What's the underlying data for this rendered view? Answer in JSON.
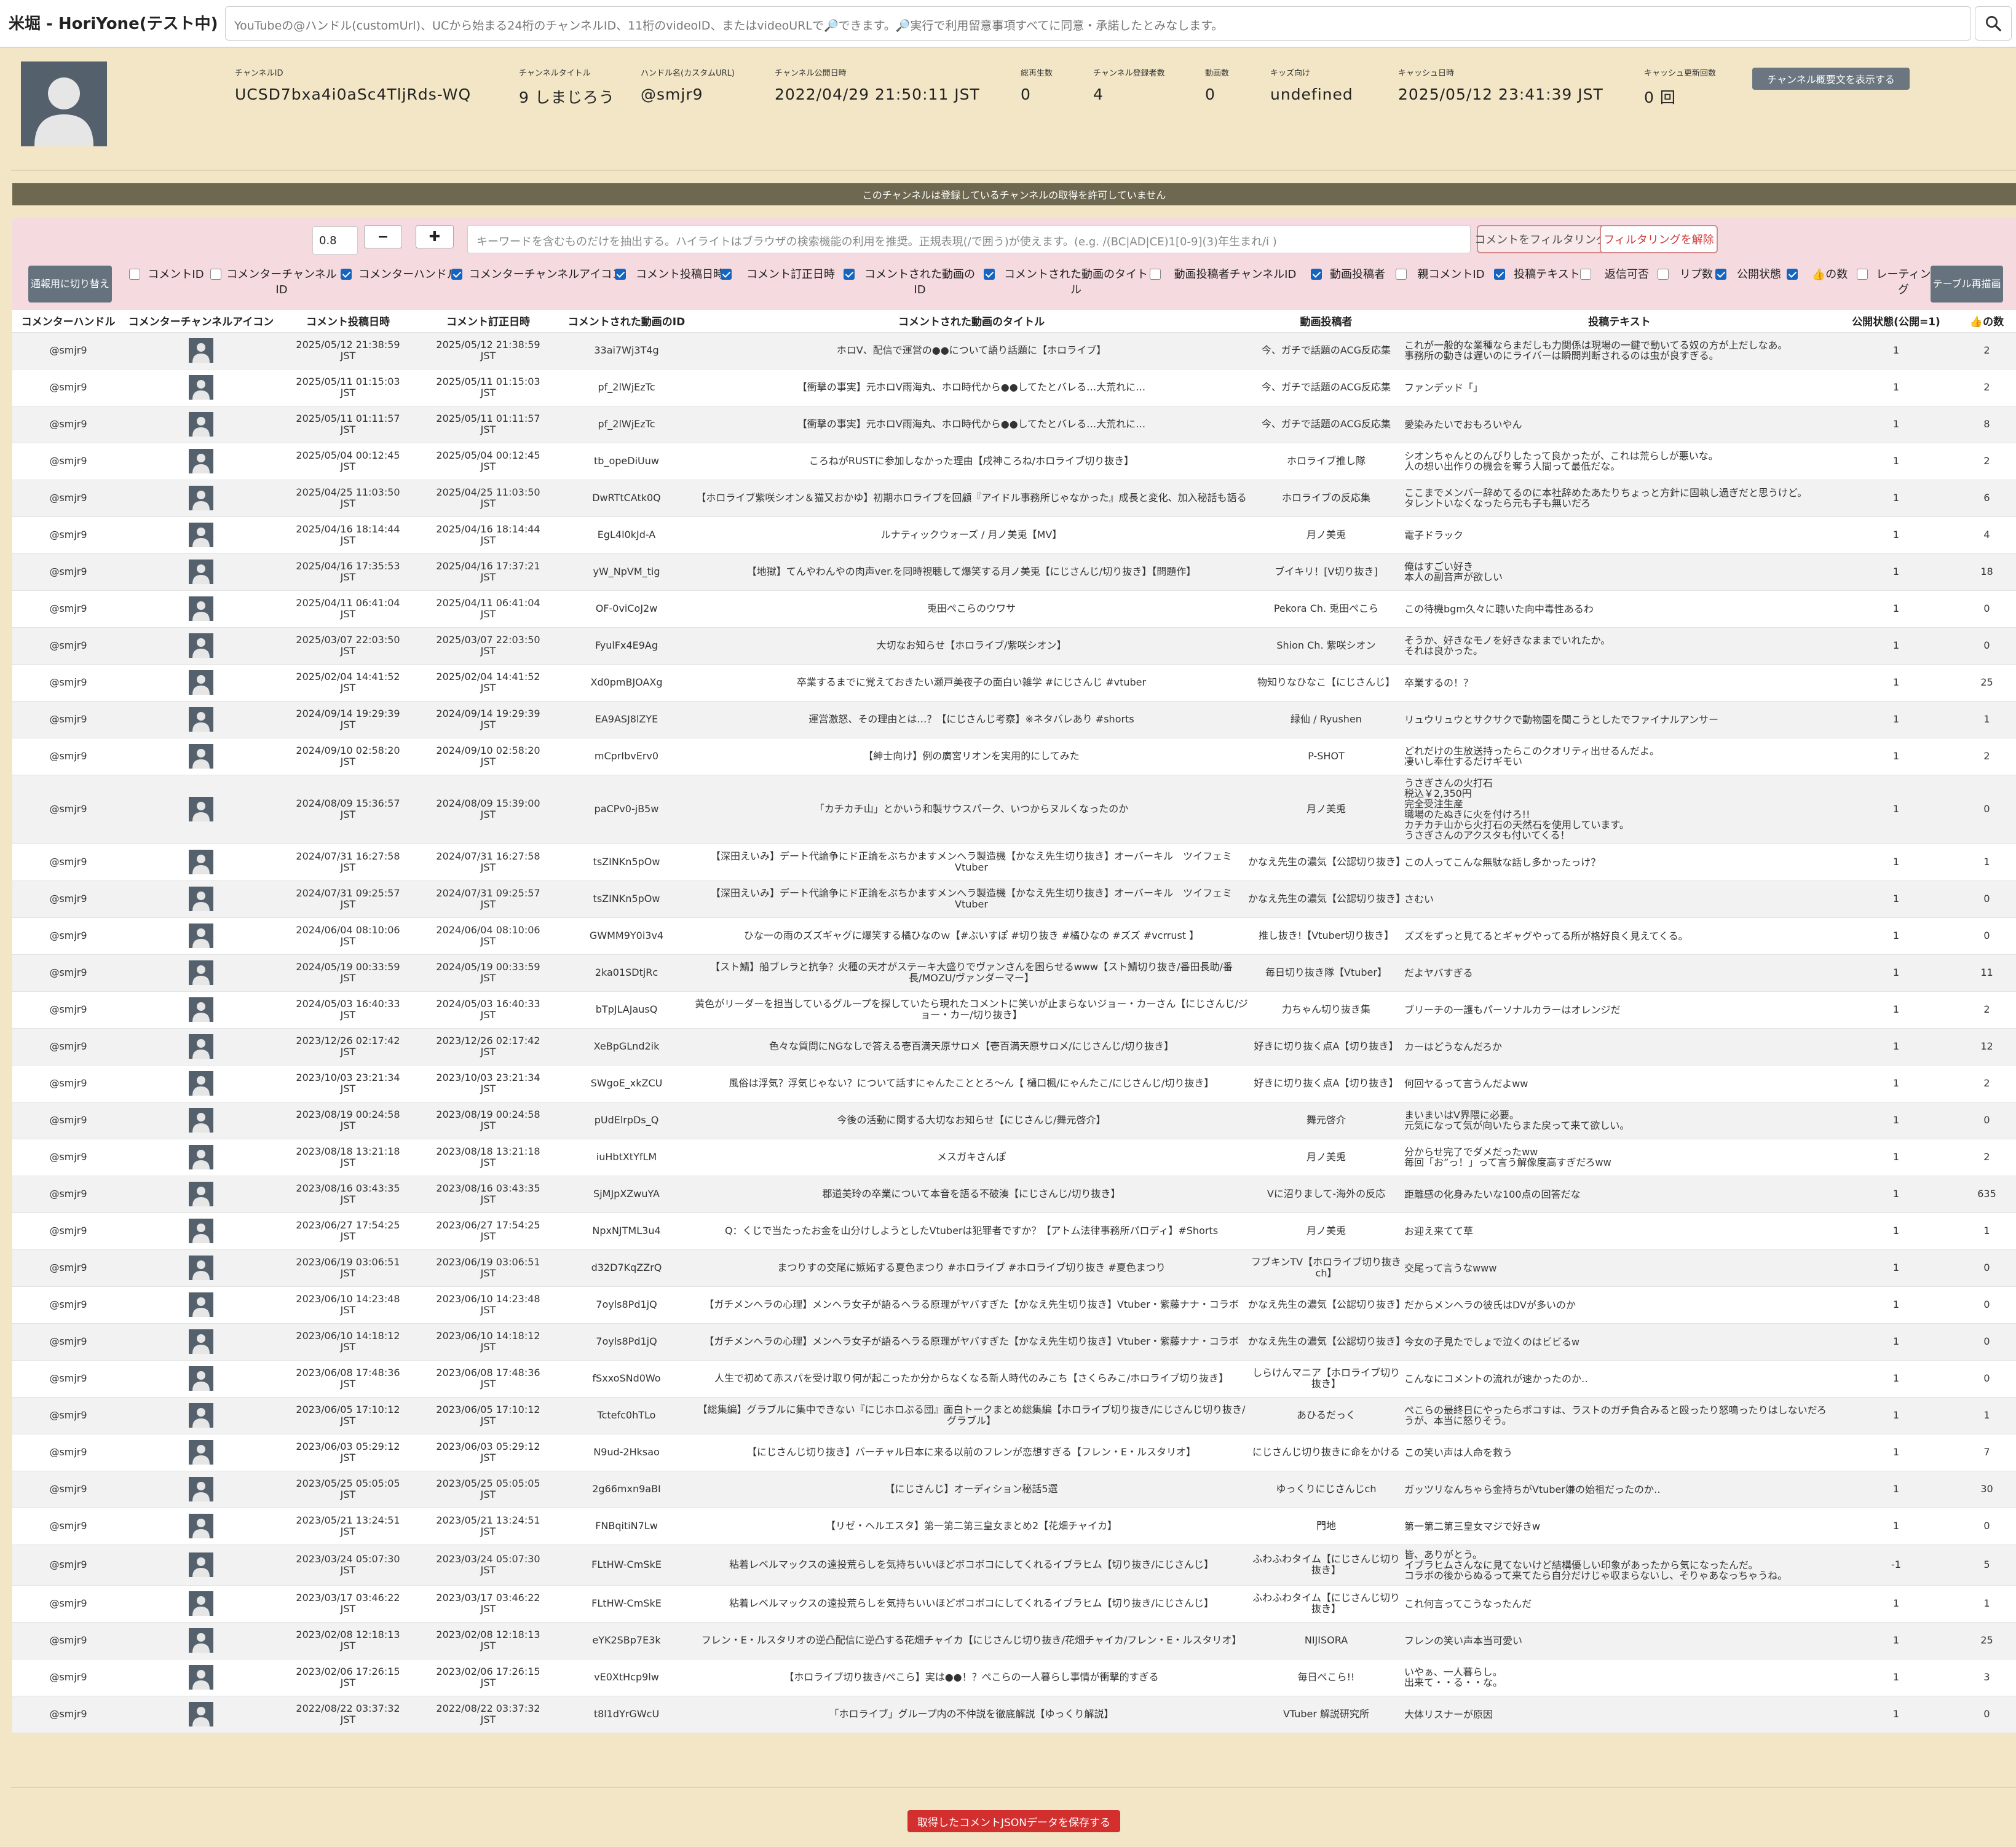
{
  "app": {
    "title": "米堀 - HoriYone(テスト中)"
  },
  "search": {
    "placeholder": "YouTubeの@ハンドル(customUrl)、UCから始まる24桁のチャンネルID、11桁のvideoID、またはvideoURLで🔎できます。🔎実行で利用留意事項すべてに同意・承諾したとみなします。"
  },
  "channel": {
    "id_label": "チャンネルID",
    "id": "UCSD7bxa4i0aSc4TljRds-WQ",
    "title_label": "チャンネルタイトル",
    "title": "9 しまじろう",
    "handle_label": "ハンドル名(カスタムURL)",
    "handle": "@smjr9",
    "published_label": "チャンネル公開日時",
    "published": "2022/04/29 21:50:11 JST",
    "views_label": "総再生数",
    "views": "0",
    "subs_label": "チャンネル登録者数",
    "subs": "4",
    "videos_label": "動画数",
    "videos": "0",
    "kids_label": "キッズ向け",
    "kids": "undefined",
    "cache_label": "キャッシュ日時",
    "cache": "2025/05/12 23:41:39 JST",
    "cache_count_label": "キャッシュ更新回数",
    "cache_count": "0 回",
    "desc_button": "チャンネル概要文を表示する"
  },
  "notice": "このチャンネルは登録しているチャンネルの取得を許可していません",
  "filter": {
    "threshold": "0.8",
    "minus": "−",
    "plus": "✚",
    "keyword_placeholder": "キーワードを含むものだけを抽出する。ハイライトはブラウザの検索機能の利用を推奨。正規表現(/で囲う)が使えます。(e.g. /(BC|AD|CE)1[0-9](3)年生まれ/i )",
    "apply_button": "コメントをフィルタリング",
    "clear_button": "フィルタリングを解除",
    "toggle_button": "通報用に切り替え",
    "rerender_button": "テーブル再描画",
    "columns": [
      {
        "label": "コメントID",
        "checked": false
      },
      {
        "label": "コメンターチャンネルID",
        "checked": false
      },
      {
        "label": "コメンターハンドル",
        "checked": true
      },
      {
        "label": "コメンターチャンネルアイコン",
        "checked": true
      },
      {
        "label": "コメント投稿日時",
        "checked": true
      },
      {
        "label": "コメント訂正日時",
        "checked": true
      },
      {
        "label": "コメントされた動画のID",
        "checked": true
      },
      {
        "label": "コメントされた動画のタイトル",
        "checked": true
      },
      {
        "label": "動画投稿者チャンネルID",
        "checked": false
      },
      {
        "label": "動画投稿者",
        "checked": true
      },
      {
        "label": "親コメントID",
        "checked": false
      },
      {
        "label": "投稿テキスト",
        "checked": true
      },
      {
        "label": "返信可否",
        "checked": false
      },
      {
        "label": "リプ数",
        "checked": false
      },
      {
        "label": "公開状態",
        "checked": true
      },
      {
        "label": "👍の数",
        "checked": true
      },
      {
        "label": "レーティング",
        "checked": false
      }
    ]
  },
  "table": {
    "headers": [
      "コメンターハンドル",
      "コメンターチャンネルアイコン",
      "コメント投稿日時",
      "コメント訂正日時",
      "コメントされた動画のID",
      "コメントされた動画のタイトル",
      "動画投稿者",
      "投稿テキスト",
      "公開状態(公開=1)",
      "👍の数"
    ],
    "rows": [
      {
        "handle": "@smjr9",
        "posted": "2025/05/12 21:38:59",
        "edited": "2025/05/12 21:38:59",
        "edited_red": false,
        "vid": "33ai7Wj3T4g",
        "title": "ホロV、配信で運営の●●について語り話題に【ホロライブ】",
        "uploader": "今、ガチで話題のACG反応集",
        "text": "これが一般的な業種ならまだしも力関係は現場の一鍵で動いてる奴の方が上だしなあ。\n事務所の動きは遅いのにライバーは瞬間判断されるのは虫が良すぎる。",
        "status": "1",
        "likes": "2"
      },
      {
        "handle": "@smjr9",
        "posted": "2025/05/11 01:15:03",
        "edited": "2025/05/11 01:15:03",
        "edited_red": false,
        "vid": "pf_2lWjEzTc",
        "title": "【衝撃の事実】元ホロV雨海丸、ホロ時代から●●してたとバレる…大荒れに…",
        "uploader": "今、ガチで話題のACG反応集",
        "text": "ファンデッド「」",
        "status": "1",
        "likes": "2"
      },
      {
        "handle": "@smjr9",
        "posted": "2025/05/11 01:11:57",
        "edited": "2025/05/11 01:11:57",
        "edited_red": false,
        "vid": "pf_2lWjEzTc",
        "title": "【衝撃の事実】元ホロV雨海丸、ホロ時代から●●してたとバレる…大荒れに…",
        "uploader": "今、ガチで話題のACG反応集",
        "text": "愛染みたいでおもろいやん",
        "status": "1",
        "likes": "8"
      },
      {
        "handle": "@smjr9",
        "posted": "2025/05/04 00:12:45",
        "edited": "2025/05/04 00:12:45",
        "edited_red": false,
        "vid": "tb_opeDiUuw",
        "title": "ころねがRUSTに参加しなかった理由【戌神ころね/ホロライブ切り抜き】",
        "uploader": "ホロライブ推し隊",
        "text": "シオンちゃんとのんびりしたって良かったが、これは荒らしが悪いな。\n人の想い出作りの機会を奪う人間って最低だな。",
        "status": "1",
        "likes": "2"
      },
      {
        "handle": "@smjr9",
        "posted": "2025/04/25 11:03:50",
        "edited": "2025/04/25 11:03:50",
        "edited_red": false,
        "vid": "DwRTtCAtk0Q",
        "title": "【ホロライブ紫咲シオン＆猫又おかゆ】初期ホロライブを回顧『アイドル事務所じゃなかった』成長と変化、加入秘話も語る",
        "uploader": "ホロライブの反応集",
        "text": "ここまでメンバー辞めてるのに本社辞めたあたりちょっと方針に固執し過ぎだと思うけど。\nタレントいなくなったら元も子も無いだろ",
        "status": "1",
        "likes": "6"
      },
      {
        "handle": "@smjr9",
        "posted": "2025/04/16 18:14:44",
        "edited": "2025/04/16 18:14:44",
        "edited_red": false,
        "vid": "EgL4l0kJd-A",
        "title": "ルナティックウォーズ / 月ノ美兎【MV】",
        "uploader": "月ノ美兎",
        "text": "電子ドラック",
        "status": "1",
        "likes": "4"
      },
      {
        "handle": "@smjr9",
        "posted": "2025/04/16 17:35:53",
        "edited": "2025/04/16 17:37:21",
        "edited_red": true,
        "vid": "yW_NpVM_tig",
        "title": "【地獄】てんやわんやの肉声ver.を同時視聴して爆笑する月ノ美兎【にじさんじ/切り抜き】【問題作】",
        "uploader": "ブイキリ！[V切り抜き]",
        "text": "俺はすごい好き\n本人の副音声が欲しい",
        "status": "1",
        "likes": "18"
      },
      {
        "handle": "@smjr9",
        "posted": "2025/04/11 06:41:04",
        "edited": "2025/04/11 06:41:04",
        "edited_red": false,
        "vid": "OF-0viCoJ2w",
        "title": "兎田ぺこらのウワサ",
        "uploader": "Pekora Ch. 兎田ぺこら",
        "text": "この待機bgm久々に聴いた向中毒性あるわ",
        "status": "1",
        "likes": "0"
      },
      {
        "handle": "@smjr9",
        "posted": "2025/03/07 22:03:50",
        "edited": "2025/03/07 22:03:50",
        "edited_red": false,
        "vid": "FyulFx4E9Ag",
        "title": "大切なお知らせ【ホロライブ/紫咲シオン】",
        "uploader": "Shion Ch. 紫咲シオン",
        "text": "そうか、好きなモノを好きなままでいれたか。\nそれは良かった。",
        "status": "1",
        "likes": "0"
      },
      {
        "handle": "@smjr9",
        "posted": "2025/02/04 14:41:52",
        "edited": "2025/02/04 14:41:52",
        "edited_red": false,
        "vid": "Xd0pmBJOAXg",
        "title": "卒業するまでに覚えておきたい瀬戸美夜子の面白い雑学 #にじさんじ #vtuber",
        "uploader": "物知りなひなこ【にじさんじ】",
        "text": "卒業するの！？",
        "status": "1",
        "likes": "25"
      },
      {
        "handle": "@smjr9",
        "posted": "2024/09/14 19:29:39",
        "edited": "2024/09/14 19:29:39",
        "edited_red": false,
        "vid": "EA9ASJ8lZYE",
        "title": "運営激怒、その理由とは…？【にじさんじ考察】※ネタバレあり #shorts",
        "uploader": "緑仙 / Ryushen",
        "text": "リュウリュウとサクサクで動物園を聞こうとしたでファイナルアンサー",
        "status": "1",
        "likes": "1"
      },
      {
        "handle": "@smjr9",
        "posted": "2024/09/10 02:58:20",
        "edited": "2024/09/10 02:58:20",
        "edited_red": false,
        "vid": "mCprIbvErv0",
        "title": "【紳士向け】例の廣宮リオンを実用的にしてみた",
        "uploader": "P-SHOT",
        "text": "どれだけの生放送持ったらこのクオリティ出せるんだよ。\n凄いし奉仕するだけギモい",
        "status": "1",
        "likes": "2"
      },
      {
        "handle": "@smjr9",
        "posted": "2024/08/09 15:36:57",
        "edited": "2024/08/09 15:39:00",
        "edited_red": true,
        "vid": "paCPv0-jB5w",
        "title": "「カチカチ山」とかいう和製サウスパーク、いつからヌルくなったのか",
        "uploader": "月ノ美兎",
        "text": "うさぎさんの火打石\n税込￥2,350円\n完全受注生産\n職場のたぬきに火を付けろ!!\nカチカチ山から火打石の天然石を使用しています。\nうさぎさんのアクスタも付いてくる！",
        "status": "1",
        "likes": "0"
      },
      {
        "handle": "@smjr9",
        "posted": "2024/07/31 16:27:58",
        "edited": "2024/07/31 16:27:58",
        "edited_red": false,
        "vid": "tsZINKn5pOw",
        "title": "【深田えいみ】デート代論争にド正論をぶちかますメンヘラ製造機【かなえ先生切り抜き】オーバーキル　ツイフェミ　Vtuber",
        "uploader": "かなえ先生の濃気【公認切り抜き】",
        "text": "この人ってこんな無駄な話し多かったっけ？",
        "status": "1",
        "likes": "1"
      },
      {
        "handle": "@smjr9",
        "posted": "2024/07/31 09:25:57",
        "edited": "2024/07/31 09:25:57",
        "edited_red": false,
        "vid": "tsZINKn5pOw",
        "title": "【深田えいみ】デート代論争にド正論をぶちかますメンヘラ製造機【かなえ先生切り抜き】オーバーキル　ツイフェミ　Vtuber",
        "uploader": "かなえ先生の濃気【公認切り抜き】",
        "text": "さむい",
        "status": "1",
        "likes": "0"
      },
      {
        "handle": "@smjr9",
        "posted": "2024/06/04 08:10:06",
        "edited": "2024/06/04 08:10:06",
        "edited_red": false,
        "vid": "GWMM9Y0i3v4",
        "title": "ひな一の雨のズズギャグに爆笑する橘ひなのｗ【#ぶいすぽ #切り抜き #橘ひなの #ズズ #vcrrust 】",
        "uploader": "推し抜き!【Vtuber切り抜き】",
        "text": "ズズをずっと見てるとギャグやってる所が格好良く見えてくる。",
        "status": "1",
        "likes": "0"
      },
      {
        "handle": "@smjr9",
        "posted": "2024/05/19 00:33:59",
        "edited": "2024/05/19 00:33:59",
        "edited_red": false,
        "vid": "2ka01SDtjRc",
        "title": "【スト鯖】船ブレラと抗争？火種の天才がステーキ大盛りでヴァンさんを困らせるwww【スト鯖切り抜き/番田長助/番長/MOZU/ヴァンダーマー】",
        "uploader": "毎日切り抜き隊【Vtuber】",
        "text": "だよヤバすぎる",
        "status": "1",
        "likes": "11"
      },
      {
        "handle": "@smjr9",
        "posted": "2024/05/03 16:40:33",
        "edited": "2024/05/03 16:40:33",
        "edited_red": false,
        "vid": "bTpJLAJausQ",
        "title": "黄色がリーダーを担当しているグループを探していたら現れたコメントに笑いが止まらないジョー・カーさん【にじさんじ/ジョー・カー/切り抜き】",
        "uploader": "力ちゃん切り抜き集",
        "text": "ブリーチの一護もパーソナルカラーはオレンジだ",
        "status": "1",
        "likes": "2"
      },
      {
        "handle": "@smjr9",
        "posted": "2023/12/26 02:17:42",
        "edited": "2023/12/26 02:17:42",
        "edited_red": false,
        "vid": "XeBpGLnd2ik",
        "title": "色々な質問にNGなしで答える壱百満天原サロメ【壱百満天原サロメ/にじさんじ/切り抜き】",
        "uploader": "好きに切り抜く点A【切り抜き】",
        "text": "カーはどうなんだろか",
        "status": "1",
        "likes": "12"
      },
      {
        "handle": "@smjr9",
        "posted": "2023/10/03 23:21:34",
        "edited": "2023/10/03 23:21:34",
        "edited_red": false,
        "vid": "SWgoE_xkZCU",
        "title": "風俗は浮気？浮気じゃない？について話すにゃんたこととろ～ん【 樋口楓/にゃんたこ/にじさんじ/切り抜き】",
        "uploader": "好きに切り抜く点A【切り抜き】",
        "text": "何回ヤるって言うんだよww",
        "status": "1",
        "likes": "2"
      },
      {
        "handle": "@smjr9",
        "posted": "2023/08/19 00:24:58",
        "edited": "2023/08/19 00:24:58",
        "edited_red": false,
        "vid": "pUdElrpDs_Q",
        "title": "今後の活動に関する大切なお知らせ【にじさんじ/舞元啓介】",
        "uploader": "舞元啓介",
        "text": "まいまいはV界隈に必要。\n元気になって気が向いたらまた戻って来て欲しい。",
        "status": "1",
        "likes": "0"
      },
      {
        "handle": "@smjr9",
        "posted": "2023/08/18 13:21:18",
        "edited": "2023/08/18 13:21:18",
        "edited_red": false,
        "vid": "iuHbtXtYfLM",
        "title": "メスガキさんぽ",
        "uploader": "月ノ美兎",
        "text": "分からせ完了でダメだったww\n毎回「お”っ！」って言う解像度高すぎだろww",
        "status": "1",
        "likes": "2"
      },
      {
        "handle": "@smjr9",
        "posted": "2023/08/16 03:43:35",
        "edited": "2023/08/16 03:43:35",
        "edited_red": false,
        "vid": "SjMJpXZwuYA",
        "title": "郡道美玲の卒業について本音を語る不破湊【にじさんじ/切り抜き】",
        "uploader": "Vに沼りまして-海外の反応",
        "text": "距離感の化身みたいな100点の回答だな",
        "status": "1",
        "likes": "635"
      },
      {
        "handle": "@smjr9",
        "posted": "2023/06/27 17:54:25",
        "edited": "2023/06/27 17:54:25",
        "edited_red": false,
        "vid": "NpxNJTML3u4",
        "title": "Q：くじで当たったお金を山分けしようとしたVtuberは犯罪者ですか？【アトム法律事務所パロディ】#Shorts",
        "uploader": "月ノ美兎",
        "text": "お迎え来てて草",
        "status": "1",
        "likes": "1"
      },
      {
        "handle": "@smjr9",
        "posted": "2023/06/19 03:06:51",
        "edited": "2023/06/19 03:06:51",
        "edited_red": false,
        "vid": "d32D7KqZZrQ",
        "title": "まつりすの交尾に嫉妬する夏色まつり #ホロライブ #ホロライブ切り抜き #夏色まつり",
        "uploader": "フブキンTV【ホロライブ切り抜きch】",
        "text": "交尾って言うなwww",
        "status": "1",
        "likes": "0"
      },
      {
        "handle": "@smjr9",
        "posted": "2023/06/10 14:23:48",
        "edited": "2023/06/10 14:23:48",
        "edited_red": false,
        "vid": "7oyls8Pd1jQ",
        "title": "【ガチメンヘラの心理】メンヘラ女子が語るヘラる原理がヤバすぎた【かなえ先生切り抜き】Vtuber・紫藤ナナ・コラボ",
        "uploader": "かなえ先生の濃気【公認切り抜き】",
        "text": "だからメンヘラの彼氏はDVが多いのか",
        "status": "1",
        "likes": "0"
      },
      {
        "handle": "@smjr9",
        "posted": "2023/06/10 14:18:12",
        "edited": "2023/06/10 14:18:12",
        "edited_red": false,
        "vid": "7oyls8Pd1jQ",
        "title": "【ガチメンヘラの心理】メンヘラ女子が語るヘラる原理がヤバすぎた【かなえ先生切り抜き】Vtuber・紫藤ナナ・コラボ",
        "uploader": "かなえ先生の濃気【公認切り抜き】",
        "text": "今女の子見たでしょで泣くのはビビるw",
        "status": "1",
        "likes": "0"
      },
      {
        "handle": "@smjr9",
        "posted": "2023/06/08 17:48:36",
        "edited": "2023/06/08 17:48:36",
        "edited_red": false,
        "vid": "fSxxoSNd0Wo",
        "title": "人生で初めて赤スパを受け取り何が起こったか分からなくなる新人時代のみこち【さくらみこ/ホロライブ切り抜き】",
        "uploader": "しらけんマニア【ホロライブ切り抜き】",
        "text": "こんなにコメントの流れが速かったのか‥",
        "status": "1",
        "likes": "0"
      },
      {
        "handle": "@smjr9",
        "posted": "2023/06/05 17:10:12",
        "edited": "2023/06/05 17:10:12",
        "edited_red": false,
        "vid": "Tctefc0hTLo",
        "title": "【総集編】グラブルに集中できない『にじホロぶる団』面白トークまとめ総集編【ホロライブ切り抜き/にじさんじ切り抜き/グラブル】",
        "uploader": "あひるだっく",
        "text": "ぺこらの最終日にやったらポコすは、ラストのガチ負合みると殴ったり怒鳴ったりはしないだろうが、本当に怒りそう。",
        "status": "1",
        "likes": "1"
      },
      {
        "handle": "@smjr9",
        "posted": "2023/06/03 05:29:12",
        "edited": "2023/06/03 05:29:12",
        "edited_red": false,
        "vid": "N9ud-2Hksao",
        "title": "【にじさんじ切り抜き】バーチャル日本に来る以前のフレンが恋想すぎる【フレン・E・ルスタリオ】",
        "uploader": "にじさんじ切り抜きに命をかける",
        "text": "この笑い声は人命を救う",
        "status": "1",
        "likes": "7"
      },
      {
        "handle": "@smjr9",
        "posted": "2023/05/25 05:05:05",
        "edited": "2023/05/25 05:05:05",
        "edited_red": false,
        "vid": "2g66mxn9aBI",
        "title": "【にじさんじ】オーディション秘話5選",
        "uploader": "ゆっくりにじさんじch",
        "text": "ガッツリなんちゃら金持ちがVtuber嫌の始祖だったのか‥",
        "status": "1",
        "likes": "30"
      },
      {
        "handle": "@smjr9",
        "posted": "2023/05/21 13:24:51",
        "edited": "2023/05/21 13:24:51",
        "edited_red": false,
        "vid": "FNBqitiN7Lw",
        "title": "【リゼ・ヘルエスタ】第一第二第三皇女まとめ2【花畑チャイカ】",
        "uploader": "門地",
        "text": "第一第二第三皇女マジで好きw",
        "status": "1",
        "likes": "0"
      },
      {
        "handle": "@smjr9",
        "posted": "2023/03/24 05:07:30",
        "edited": "2023/03/24 05:07:30",
        "edited_red": false,
        "vid": "FLtHW-CmSkE",
        "title": "粘着レベルマックスの遠投荒らしを気持ちいいほどボコボコにしてくれるイブラヒム【切り抜き/にじさんじ】",
        "uploader": "ふわふわタイム【にじさんじ切り抜き】",
        "text": "皆、ありがとう。\nイブラヒムさんなに見てないけど結構優しい印象があったから気になったんだ。\nコラボの後からぬるって来てたら自分だけじゃ収まらないし、そりゃあなっちゃうね。",
        "status": "-1",
        "likes": "5"
      },
      {
        "handle": "@smjr9",
        "posted": "2023/03/17 03:46:22",
        "edited": "2023/03/17 03:46:22",
        "edited_red": false,
        "vid": "FLtHW-CmSkE",
        "title": "粘着レベルマックスの遠投荒らしを気持ちいいほどボコボコにしてくれるイブラヒム【切り抜き/にじさんじ】",
        "uploader": "ふわふわタイム【にじさんじ切り抜き】",
        "text": "これ何言ってこうなったんだ",
        "status": "1",
        "likes": "1"
      },
      {
        "handle": "@smjr9",
        "posted": "2023/02/08 12:18:13",
        "edited": "2023/02/08 12:18:13",
        "edited_red": false,
        "vid": "eYK2SBp7E3k",
        "title": "フレン・E・ルスタリオの逆凸配信に逆凸する花畑チャイカ【にじさんじ切り抜き/花畑チャイカ/フレン・E・ルスタリオ】",
        "uploader": "NIJISORA",
        "text": "フレンの笑い声本当可愛い",
        "status": "1",
        "likes": "25"
      },
      {
        "handle": "@smjr9",
        "posted": "2023/02/06 17:26:15",
        "edited": "2023/02/06 17:26:15",
        "edited_red": false,
        "vid": "vE0XtHcp9lw",
        "title": "【ホロライブ切り抜き/ぺこら】実は●●！？ぺこらの一人暮らし事情が衝撃的すぎる",
        "uploader": "毎日ぺこら!!",
        "text": "いやぁ、一人暮らし。\n出来て・・る・・な。",
        "status": "1",
        "likes": "3"
      },
      {
        "handle": "@smjr9",
        "posted": "2022/08/22 03:37:32",
        "edited": "2022/08/22 03:37:32",
        "edited_red": false,
        "vid": "t8l1dYrGWcU",
        "title": "「ホロライブ」グループ内の不仲説を徹底解説【ゆっくり解説】",
        "uploader": "VTuber 解説研究所",
        "text": "大体リスナーが原因",
        "status": "1",
        "likes": "0"
      }
    ]
  },
  "footer": {
    "save_button": "取得したコメントJSONデータを保存する"
  }
}
